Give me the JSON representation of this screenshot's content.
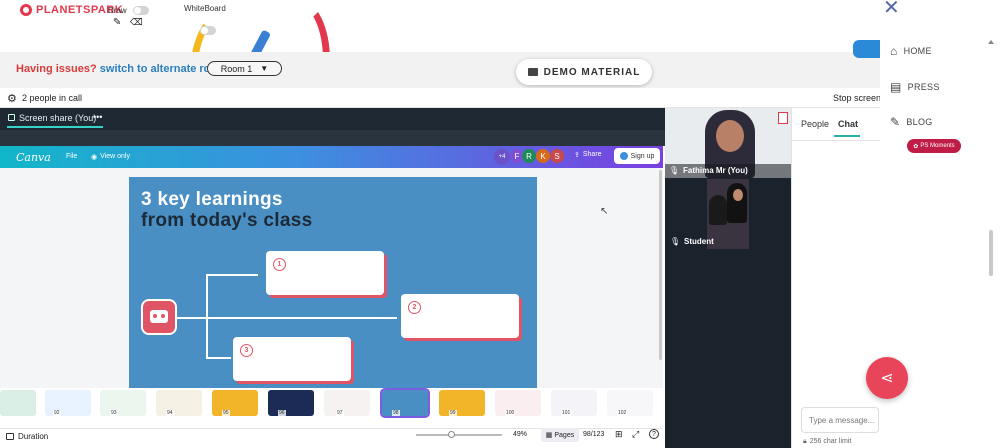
{
  "topbar": {
    "logo_text": "PLANETSPARK",
    "draw_label": "Draw",
    "whiteboard_label": "WhiteBoard"
  },
  "issues": {
    "prefix": "Having issues?",
    "link": "switch to alternate room",
    "room_value": "Room 1"
  },
  "demo_button": "DEMO MATERIAL",
  "call": {
    "people_count": "2 people in call",
    "stop_screen": "Stop screen"
  },
  "screenshare": {
    "tab_label": "Screen share (You)",
    "more": "•••"
  },
  "canva": {
    "logo": "Canva",
    "file": "File",
    "view_only": "View only",
    "plus_count": "+4",
    "avatars": [
      "F",
      "R",
      "K",
      "S"
    ],
    "share": "Share",
    "sign_up": "Sign up"
  },
  "slide": {
    "title_line1": "3 key learnings",
    "title_line2": "from today's class",
    "items": [
      "1",
      "2",
      "3"
    ]
  },
  "thumbnails": [
    "92",
    "93",
    "94",
    "95",
    "96",
    "97",
    "98",
    "99",
    "100",
    "101",
    "102"
  ],
  "canva_footer": {
    "duration": "Duration",
    "zoom": "49%",
    "pages": "Pages",
    "page_count": "98/123"
  },
  "videos": {
    "tile1_name": "Fathima Mr (You)",
    "tile2_name": "Student"
  },
  "chat_panel": {
    "tab_people": "People",
    "tab_chat": "Chat",
    "input_placeholder": "Type a message...",
    "char_limit": "256 char limit"
  },
  "rightnav": {
    "home": "HOME",
    "press": "PRESS",
    "blog": "BLOG",
    "badge": "PS Moments"
  },
  "colors": {
    "accent_red": "#e2384d",
    "link_blue": "#2a7fbf",
    "slide_blue": "#4a8fc4",
    "share_fab": "#e8455a"
  },
  "icons": [
    "pencil-icon",
    "eraser-icon",
    "gear-icon",
    "folder-icon",
    "close-icon",
    "home-icon",
    "press-icon",
    "blog-icon",
    "share-icon",
    "mic-icon",
    "lock-icon",
    "robot-icon"
  ]
}
